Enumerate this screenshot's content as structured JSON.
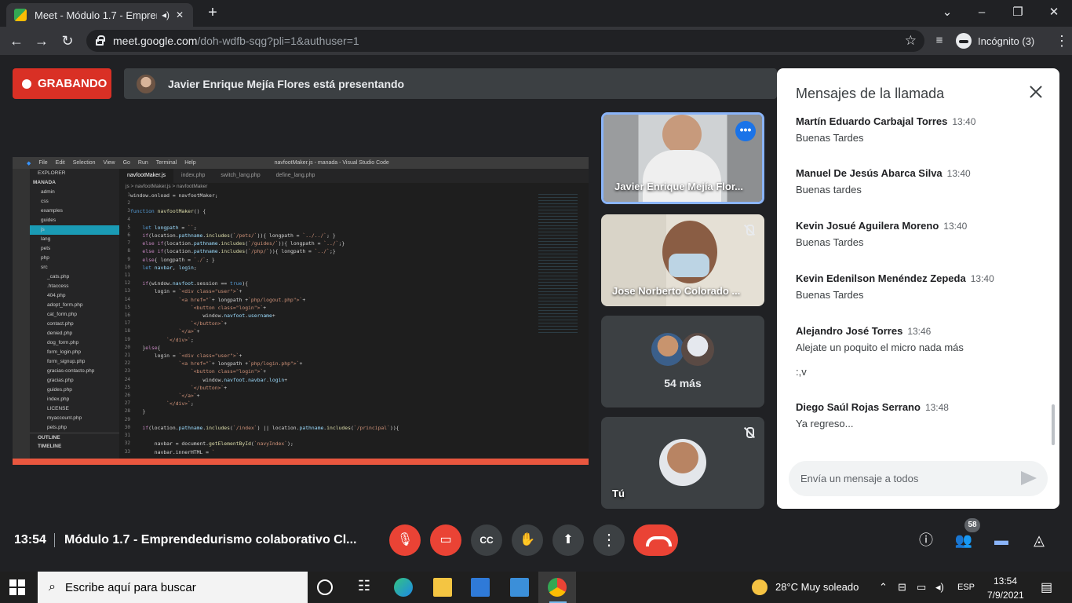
{
  "browser": {
    "tab_title": "Meet - Módulo 1.7 - Empren",
    "url_host": "meet.google.com",
    "url_path": "/doh-wdfb-sqg?pli=1&authuser=1",
    "incognito_label": "Incógnito (3)"
  },
  "meet": {
    "recording_label": "GRABANDO",
    "presenting_text": "Javier Enrique Mejía Flores está presentando",
    "participants": [
      {
        "name": "Javier Enrique Mejía Flor..."
      },
      {
        "name": "Jose Norberto Colorado ..."
      },
      {
        "name": "54 más"
      },
      {
        "name": "Tú"
      }
    ],
    "time": "13:54",
    "meeting_name": "Módulo 1.7 - Emprendedurismo colaborativo Cl...",
    "people_count": "58"
  },
  "vscode": {
    "title": "navfootMaker.js - manada - Visual Studio Code",
    "menu": [
      "File",
      "Edit",
      "Selection",
      "View",
      "Go",
      "Run",
      "Terminal",
      "Help"
    ],
    "explorer_label": "EXPLORER",
    "folder": "MANADA",
    "tabs": [
      "navfootMaker.js",
      "index.php",
      "switch_lang.php",
      "define_lang.php"
    ],
    "breadcrumb": "js > navfootMaker.js > navfootMaker",
    "tree": [
      "admin",
      "css",
      "examples",
      "guides",
      "js",
      "lang",
      "pets",
      "php",
      "src",
      "_cats.php",
      ".htaccess",
      "404.php",
      "adopt_form.php",
      "cat_form.php",
      "contact.php",
      "denied.php",
      "dog_form.php",
      "form_login.php",
      "form_signup.php",
      "gracias-contacto.php",
      "gracias.php",
      "guides.php",
      "index.php",
      "LICENSE",
      "myaccount.php",
      "pets.php"
    ],
    "outline": "OUTLINE",
    "timeline": "TIMELINE"
  },
  "chat": {
    "title": "Mensajes de la llamada",
    "messages": [
      {
        "name": "Martín Eduardo Carbajal Torres",
        "time": "13:40",
        "text": "Buenas Tardes"
      },
      {
        "name": "Manuel De Jesús Abarca Silva",
        "time": "13:40",
        "text": "Buenas tardes"
      },
      {
        "name": "Kevin Josué Aguilera Moreno",
        "time": "13:40",
        "text": "Buenas Tardes"
      },
      {
        "name": "Kevin Edenilson Menéndez Zepeda",
        "time": "13:40",
        "text": "Buenas Tardes"
      },
      {
        "name": "Alejandro José Torres",
        "time": "13:46",
        "text": "Alejate un poquito el micro nada más",
        "text2": ":,v"
      },
      {
        "name": "Diego Saúl Rojas Serrano",
        "time": "13:48",
        "text": "Ya regreso..."
      }
    ],
    "input_placeholder": "Envía un mensaje a todos"
  },
  "taskbar": {
    "search_placeholder": "Escribe aquí para buscar",
    "weather": "28°C  Muy soleado",
    "lang": "ESP",
    "time": "13:54",
    "date": "7/9/2021"
  }
}
